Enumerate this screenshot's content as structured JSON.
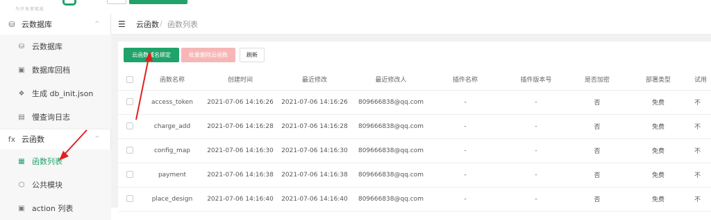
{
  "topbar": {
    "logo_subtext": "为开发者赋能"
  },
  "sidebar": {
    "groups": [
      {
        "label": "云数据库",
        "icon": "database-icon",
        "chevron": "^",
        "items": [
          {
            "label": "云数据库",
            "icon": "database-icon"
          },
          {
            "label": "数据库回档",
            "icon": "rollback-icon"
          },
          {
            "label": "生成 db_init.json",
            "icon": "generate-icon"
          },
          {
            "label": "慢查询日志",
            "icon": "log-icon"
          }
        ]
      },
      {
        "label": "云函数",
        "icon": "function-icon",
        "icon_text": "fx",
        "chevron": "^",
        "items": [
          {
            "label": "函数列表",
            "icon": "function-list-icon",
            "active": true
          },
          {
            "label": "公共模块",
            "icon": "module-icon"
          },
          {
            "label": "action 列表",
            "icon": "action-icon"
          }
        ]
      }
    ]
  },
  "header": {
    "breadcrumb": [
      "云函数",
      "函数列表"
    ],
    "separator": "/"
  },
  "toolbar": {
    "bind_domain": "云函数域名绑定",
    "batch_delete": "批量删除云函数",
    "refresh": "刷新"
  },
  "table": {
    "columns": [
      "函数名称",
      "创建时间",
      "最近修改",
      "最近修改人",
      "插件名称",
      "插件版本号",
      "是否加密",
      "部署类型",
      "试用"
    ],
    "rows": [
      [
        "access_token",
        "2021-07-06 14:16:26",
        "2021-07-06 14:16:26",
        "809666838@qq.com",
        "-",
        "-",
        "否",
        "免费",
        "不"
      ],
      [
        "charge_add",
        "2021-07-06 14:16:28",
        "2021-07-06 14:16:28",
        "809666838@qq.com",
        "-",
        "-",
        "否",
        "免费",
        "不"
      ],
      [
        "config_map",
        "2021-07-06 14:16:30",
        "2021-07-06 14:16:30",
        "809666838@qq.com",
        "-",
        "-",
        "否",
        "免费",
        "不"
      ],
      [
        "payment",
        "2021-07-06 14:16:38",
        "2021-07-06 14:16:38",
        "809666838@qq.com",
        "-",
        "-",
        "否",
        "免费",
        "不"
      ],
      [
        "place_design",
        "2021-07-06 14:16:40",
        "2021-07-06 14:16:40",
        "809666838@qq.com",
        "-",
        "-",
        "否",
        "免费",
        "不"
      ]
    ]
  },
  "colors": {
    "accent": "#1fa36a",
    "danger_light": "#f7b6b6",
    "annotation_arrow": "#e02020"
  }
}
